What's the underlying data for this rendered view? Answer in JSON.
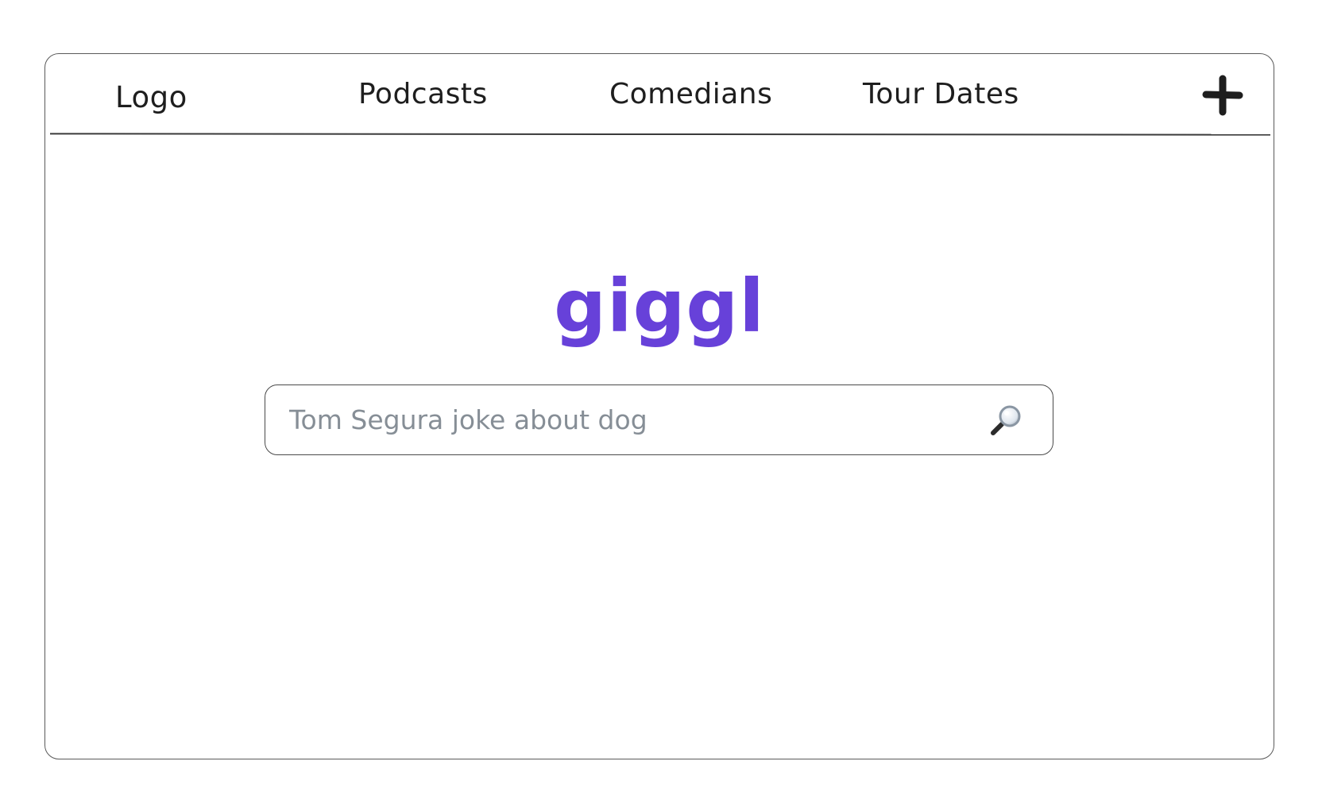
{
  "navbar": {
    "logo_label": "Logo",
    "links": [
      {
        "label": "Podcasts"
      },
      {
        "label": "Comedians"
      },
      {
        "label": "Tour Dates"
      }
    ],
    "add_icon": "plus-icon"
  },
  "brand": {
    "name": "giggl",
    "color": "#6741d9"
  },
  "search": {
    "placeholder": "Tom Segura joke about dog",
    "icon": "magnifying-glass-icon"
  },
  "colors": {
    "text": "#1e1e1e",
    "placeholder": "#868e96",
    "border": "#4a4a4a"
  }
}
